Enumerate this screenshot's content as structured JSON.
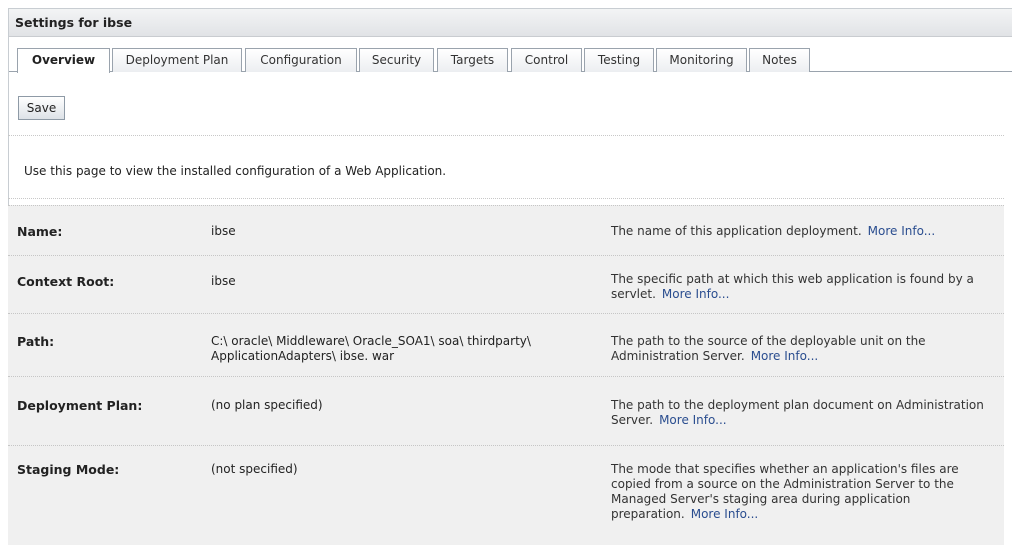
{
  "header": {
    "title": "Settings for ibse"
  },
  "tabs": [
    {
      "label": "Overview"
    },
    {
      "label": "Deployment Plan"
    },
    {
      "label": "Configuration"
    },
    {
      "label": "Security"
    },
    {
      "label": "Targets"
    },
    {
      "label": "Control"
    },
    {
      "label": "Testing"
    },
    {
      "label": "Monitoring"
    },
    {
      "label": "Notes"
    }
  ],
  "toolbar": {
    "save_label": "Save"
  },
  "page_description": "Use this page to view the installed configuration of a Web Application.",
  "more_info_label": "More Info...",
  "fields": [
    {
      "label": "Name:",
      "value": "ibse",
      "help": "The name of this application deployment."
    },
    {
      "label": "Context Root:",
      "value": "ibse",
      "help": "The specific path at which this web application is found by a servlet."
    },
    {
      "label": "Path:",
      "value": "C:\\ oracle\\ Middleware\\ Oracle_SOA1\\ soa\\ thirdparty\\ ApplicationAdapters\\ ibse. war",
      "help": "The path to the source of the deployable unit on the Administration Server."
    },
    {
      "label": "Deployment Plan:",
      "value": "(no plan specified)",
      "help": "The path to the deployment plan document on Administration Server."
    },
    {
      "label": "Staging Mode:",
      "value": "(not specified)",
      "help": "The mode that specifies whether an application's files are copied from a source on the Administration Server to the Managed Server's staging area during application preparation."
    }
  ]
}
